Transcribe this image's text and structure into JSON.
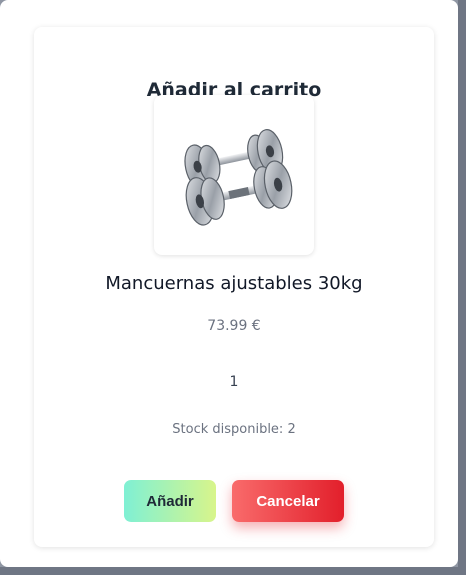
{
  "modal": {
    "title": "Añadir al carrito",
    "product": {
      "name": "Mancuernas ajustables 30kg",
      "price": "73.99 €",
      "image_icon": "dumbbell-image"
    },
    "quantity": "1",
    "stock_text": "Stock disponible: 2",
    "buttons": {
      "add_label": "Añadir",
      "cancel_label": "Cancelar"
    }
  },
  "colors": {
    "add_gradient_start": "#7ff0d4",
    "add_gradient_end": "#d8f58b",
    "cancel_gradient_start": "#f96b6b",
    "cancel_gradient_end": "#e21f2b"
  }
}
